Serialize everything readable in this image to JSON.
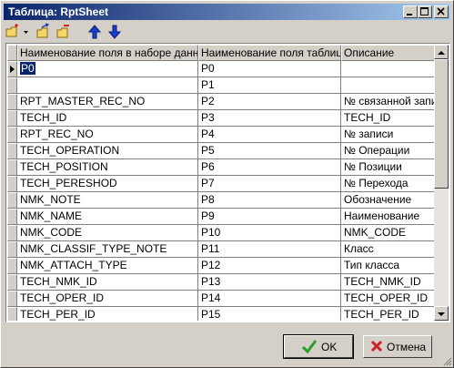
{
  "window": {
    "title": "Таблица: RptSheet",
    "title_buttons": [
      "minimize-icon",
      "maximize-icon",
      "close-icon"
    ]
  },
  "toolbar": {
    "icons": [
      "add-field-icon",
      "dropdown-arrow-icon",
      "copy-fields-icon",
      "delete-fields-icon",
      "move-up-icon",
      "move-down-icon"
    ]
  },
  "grid": {
    "columns": [
      "Наименование поля в наборе данных",
      "Наименование поля таблицы",
      "Описание"
    ],
    "rows": [
      [
        "P0",
        "P0",
        ""
      ],
      [
        "",
        "P1",
        ""
      ],
      [
        "RPT_MASTER_REC_NO",
        "P2",
        "№ связанной запи"
      ],
      [
        "TECH_ID",
        "P3",
        "TECH_ID"
      ],
      [
        "RPT_REC_NO",
        "P4",
        "№ записи"
      ],
      [
        "TECH_OPERATION",
        "P5",
        "№ Операции"
      ],
      [
        "TECH_POSITION",
        "P6",
        "№ Позиции"
      ],
      [
        "TECH_PERESHOD",
        "P7",
        "№ Перехода"
      ],
      [
        "NMK_NOTE",
        "P8",
        "Обозначение"
      ],
      [
        "NMK_NAME",
        "P9",
        "Наименование"
      ],
      [
        "NMK_CODE",
        "P10",
        "NMK_CODE"
      ],
      [
        "NMK_CLASSIF_TYPE_NOTE",
        "P11",
        "Класс"
      ],
      [
        "NMK_ATTACH_TYPE",
        "P12",
        "Тип класса"
      ],
      [
        "TECH_NMK_ID",
        "P13",
        "TECH_NMK_ID"
      ],
      [
        "TECH_OPER_ID",
        "P14",
        "TECH_OPER_ID"
      ],
      [
        "TECH_PER_ID",
        "P15",
        "TECH_PER_ID"
      ]
    ],
    "selected_row": 0
  },
  "buttons": {
    "ok_label": "OK",
    "cancel_label": "Отмена"
  },
  "colors": {
    "title_start": "#0a246a",
    "title_end": "#a6caf0",
    "selection": "#0a246a",
    "ok_check": "#2a9d2a",
    "cancel_x": "#cc2222"
  }
}
